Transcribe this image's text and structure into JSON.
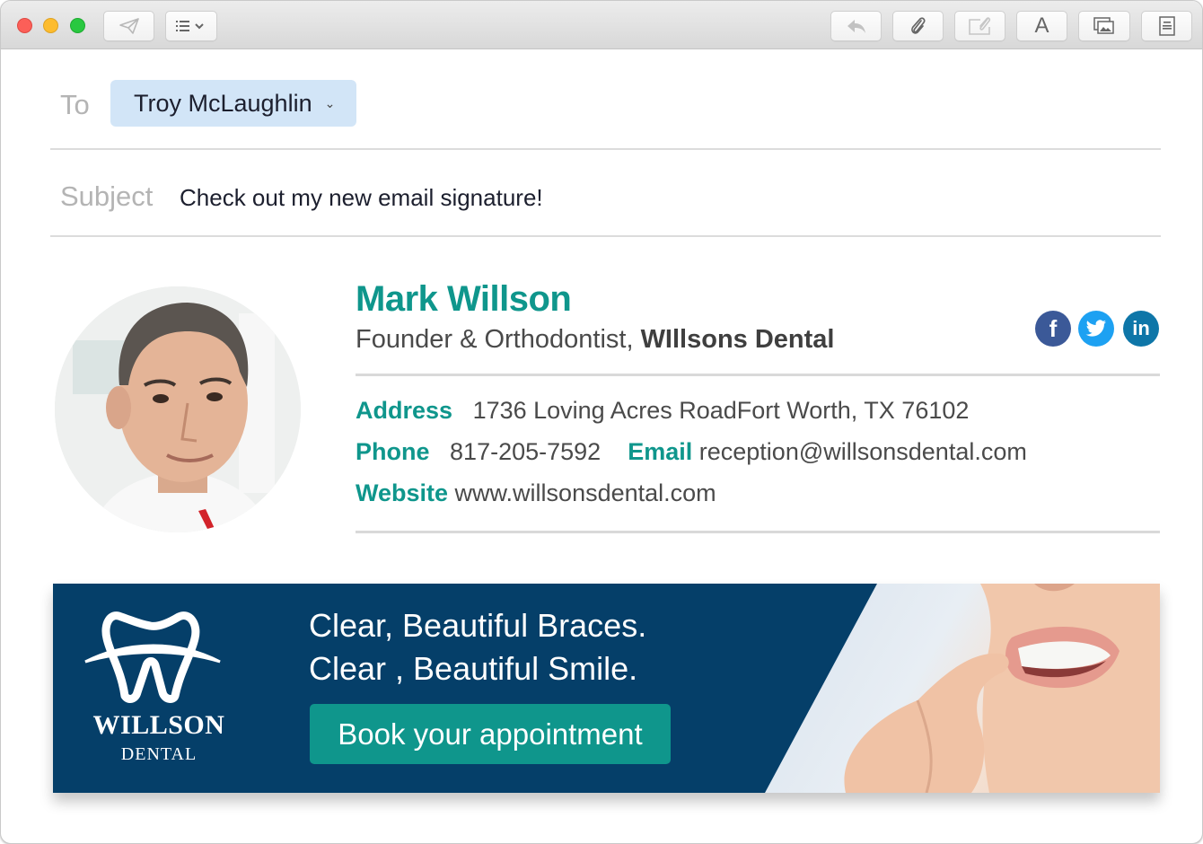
{
  "window": {
    "toolbar_left": [
      {
        "name": "send",
        "icon": "paper-plane-icon"
      },
      {
        "name": "header-fields",
        "icon": "list-icon",
        "has_dropdown": true
      }
    ],
    "toolbar_right": [
      {
        "name": "reply",
        "icon": "reply-arrow-icon"
      },
      {
        "name": "attach",
        "icon": "paperclip-icon"
      },
      {
        "name": "attach-inline",
        "icon": "attach-document-icon"
      },
      {
        "name": "format",
        "icon": "font-icon",
        "glyph": "A"
      },
      {
        "name": "photo-browser",
        "icon": "photo-icon"
      },
      {
        "name": "stationery",
        "icon": "stationery-icon"
      }
    ]
  },
  "compose": {
    "to_label": "To",
    "recipient": "Troy McLaughlin",
    "subject_label": "Subject",
    "subject": "Check out my new email signature!"
  },
  "signature": {
    "name": "Mark Willson",
    "title": "Founder & Orthodontist, ",
    "company": "WIllsons Dental",
    "address_label": "Address",
    "address": "1736 Loving Acres RoadFort Worth, TX 76102",
    "phone_label": "Phone",
    "phone": "817-205-7592",
    "email_label": "Email",
    "email": "reception@willsonsdental.com",
    "website_label": "Website",
    "website": "www.willsonsdental.com",
    "social": [
      {
        "network": "facebook",
        "icon": "facebook-icon",
        "glyph": "f",
        "color": "#3b5998"
      },
      {
        "network": "twitter",
        "icon": "twitter-icon",
        "color": "#1da1f2"
      },
      {
        "network": "linkedin",
        "icon": "linkedin-icon",
        "glyph": "in",
        "color": "#0e76a8"
      }
    ],
    "accent_color": "#0f968c"
  },
  "banner": {
    "brand_name": "WILLSON",
    "brand_sub": "DENTAL",
    "headline_1": "Clear, Beautiful Braces.",
    "headline_2": "Clear , Beautiful Smile.",
    "cta": "Book your appointment",
    "background_color": "#053f69",
    "cta_color": "#0f968c"
  }
}
